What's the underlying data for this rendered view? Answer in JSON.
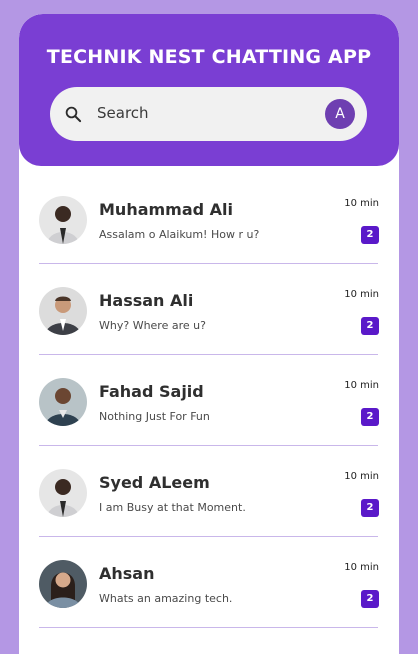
{
  "app": {
    "title": "TECHNIK NEST CHATTING APP"
  },
  "search": {
    "placeholder": "Search",
    "avatar_letter": "A",
    "icon": "search-icon"
  },
  "colors": {
    "background": "#b497e4",
    "header": "#7a3ed3",
    "badge": "#5a19c9",
    "divider": "#c9b7ea"
  },
  "chats": [
    {
      "name": "Muhammad Ali",
      "message": "Assalam o Alaikum! How r u?",
      "time": "10 min",
      "unread": "2"
    },
    {
      "name": "Hassan Ali",
      "message": "Why? Where are u?",
      "time": "10 min",
      "unread": "2"
    },
    {
      "name": "Fahad Sajid",
      "message": "Nothing Just For Fun",
      "time": "10 min",
      "unread": "2"
    },
    {
      "name": "Syed ALeem",
      "message": "I am Busy at that Moment.",
      "time": "10 min",
      "unread": "2"
    },
    {
      "name": "Ahsan",
      "message": "Whats an amazing tech.",
      "time": "10 min",
      "unread": "2"
    }
  ]
}
